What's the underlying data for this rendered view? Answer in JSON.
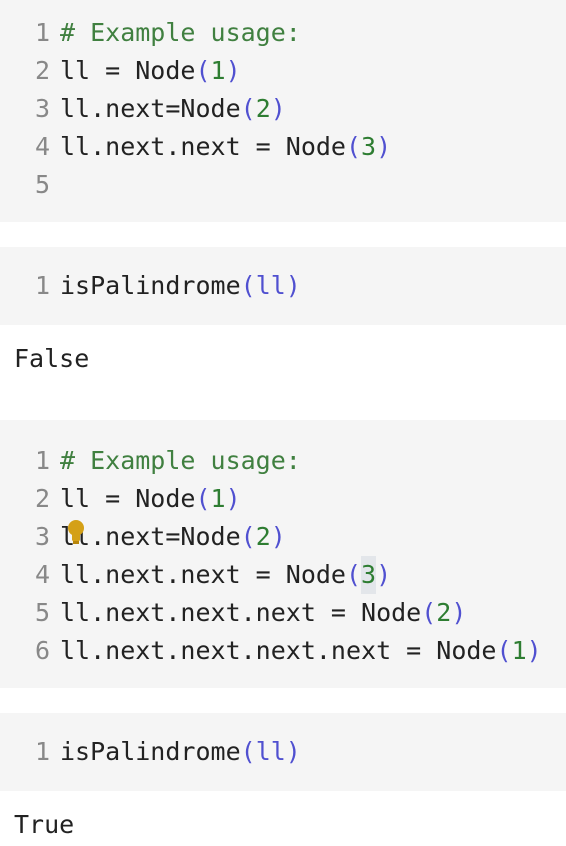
{
  "cells": [
    {
      "lines": [
        {
          "n": "1",
          "parts": [
            {
              "t": "# Example usage:",
              "c": "comment"
            }
          ]
        },
        {
          "n": "2",
          "parts": [
            {
              "t": "ll = Node",
              "c": ""
            },
            {
              "t": "(",
              "c": "paren"
            },
            {
              "t": "1",
              "c": "num"
            },
            {
              "t": ")",
              "c": "paren"
            }
          ]
        },
        {
          "n": "3",
          "parts": [
            {
              "t": "ll.next=Node",
              "c": ""
            },
            {
              "t": "(",
              "c": "paren"
            },
            {
              "t": "2",
              "c": "num"
            },
            {
              "t": ")",
              "c": "paren"
            }
          ]
        },
        {
          "n": "4",
          "parts": [
            {
              "t": "ll.next.next = Node",
              "c": ""
            },
            {
              "t": "(",
              "c": "paren"
            },
            {
              "t": "3",
              "c": "num"
            },
            {
              "t": ")",
              "c": "paren"
            }
          ]
        },
        {
          "n": "5",
          "parts": []
        }
      ]
    },
    {
      "lines": [
        {
          "n": "1",
          "parts": [
            {
              "t": "isPalindrome",
              "c": ""
            },
            {
              "t": "(",
              "c": "paren"
            },
            {
              "t": "ll",
              "c": "paren"
            },
            {
              "t": ")",
              "c": "paren"
            }
          ]
        }
      ]
    },
    {
      "lines": [
        {
          "n": "1",
          "parts": [
            {
              "t": "# Example usage:",
              "c": "comment"
            }
          ]
        },
        {
          "n": "2",
          "parts": [
            {
              "t": "ll = Node",
              "c": ""
            },
            {
              "t": "(",
              "c": "paren"
            },
            {
              "t": "1",
              "c": "num"
            },
            {
              "t": ")",
              "c": "paren"
            }
          ]
        },
        {
          "n": "3",
          "parts": [
            {
              "t": "ll.next=Node",
              "c": ""
            },
            {
              "t": "(",
              "c": "paren"
            },
            {
              "t": "2",
              "c": "num"
            },
            {
              "t": ")",
              "c": "paren"
            }
          ]
        },
        {
          "n": "4",
          "parts": [
            {
              "t": "ll.next.next = Node",
              "c": ""
            },
            {
              "t": "(",
              "c": "paren"
            },
            {
              "t": "3",
              "c": "num",
              "cursor": true
            },
            {
              "t": ")",
              "c": "paren"
            }
          ]
        },
        {
          "n": "5",
          "parts": [
            {
              "t": "ll.next.next.next = Node",
              "c": ""
            },
            {
              "t": "(",
              "c": "paren"
            },
            {
              "t": "2",
              "c": "num"
            },
            {
              "t": ")",
              "c": "paren"
            }
          ]
        },
        {
          "n": "6",
          "parts": [
            {
              "t": "ll.next.next.next.next = Node",
              "c": ""
            },
            {
              "t": "(",
              "c": "paren"
            },
            {
              "t": "1",
              "c": "num"
            },
            {
              "t": ")",
              "c": "paren"
            }
          ]
        }
      ]
    },
    {
      "lines": [
        {
          "n": "1",
          "parts": [
            {
              "t": "isPalindrome",
              "c": ""
            },
            {
              "t": "(",
              "c": "paren"
            },
            {
              "t": "ll",
              "c": "paren"
            },
            {
              "t": ")",
              "c": "paren"
            }
          ]
        }
      ]
    }
  ],
  "outputs": {
    "first": "False",
    "second": "True"
  },
  "icons": {
    "lightbulb": "lightbulb-icon",
    "lightbulb_color": "#d4a017"
  }
}
